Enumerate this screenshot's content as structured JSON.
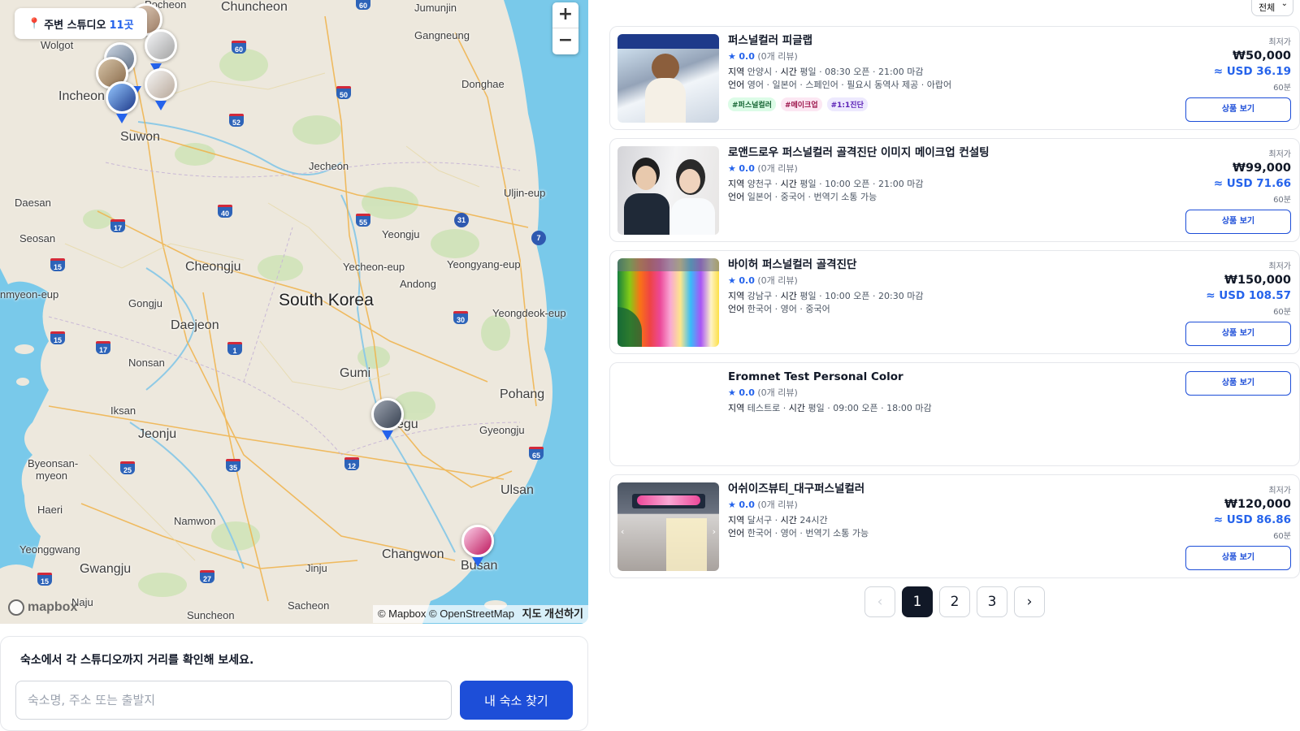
{
  "map": {
    "nearby_prefix": "주변 스튜디오",
    "nearby_count": "11곳",
    "zoom_in": "+",
    "zoom_out": "−",
    "logo_text": "mapbox",
    "attribution": "© Mapbox © OpenStreetMap",
    "improve_map": "지도 개선하기",
    "labels": {
      "pocheon": "Pocheon",
      "chuncheon": "Chuncheon",
      "jumunjin": "Jumunjin",
      "wolgot": "Wolgot",
      "gangneung": "Gangneung",
      "incheon": "Incheon",
      "donghae": "Donghae",
      "suwon": "Suwon",
      "jecheon": "Jecheon",
      "daesan": "Daesan",
      "uljin": "Uljin-eup",
      "seosan": "Seosan",
      "yeongju": "Yeongju",
      "cheongju": "Cheongju",
      "yecheon": "Yecheon-eup",
      "yeongyang": "Yeongyang-eup",
      "andong": "Andong",
      "hongseong": "nmyeon-eup",
      "gongju": "Gongju",
      "south_korea": "South Korea",
      "daejeon": "Daejeon",
      "yeongdeok": "Yeongdeok-eup",
      "nonsan": "Nonsan",
      "gumi": "Gumi",
      "pohang": "Pohang",
      "iksan": "Iksan",
      "daegu": "egu",
      "gyeongju": "Gyeongju",
      "jeonju": "Jeonju",
      "byeongsan": "Byeonsan-",
      "myeon": "myeon",
      "ulsan": "Ulsan",
      "haeri": "Haeri",
      "namwon": "Namwon",
      "yeonggwang": "Yeonggwang",
      "changwon": "Changwon",
      "gwangju": "Gwangju",
      "jinju": "Jinju",
      "busan": "Busan",
      "naju": "Naju",
      "suncheon": "Suncheon",
      "sacheon": "Sacheon"
    },
    "highways": [
      "60",
      "60",
      "50",
      "52",
      "40",
      "55",
      "31",
      "7",
      "17",
      "15",
      "30",
      "15",
      "17",
      "1",
      "65",
      "25",
      "35",
      "12",
      "27",
      "15"
    ]
  },
  "distance": {
    "title": "숙소에서 각 스튜디오까지 거리를 확인해 보세요.",
    "placeholder": "숙소명, 주소 또는 출발지",
    "button": "내 숙소 찾기"
  },
  "sort": {
    "label": "전체"
  },
  "listings": [
    {
      "title": "퍼스널컬러 피글랩",
      "rating": "0.0",
      "reviews": "(0개 리뷰)",
      "region_label": "지역",
      "region": "안양시",
      "hours_label": "시간",
      "hours": "평일 · 08:30 오픈 · 21:00 마감",
      "lang_label": "언어",
      "languages": "영어 · 일본어 · 스페인어 · 필요시 동역사 제공 · 아랍어",
      "tags": [
        "#퍼스널컬러",
        "#메이크업",
        "#1:1진단"
      ],
      "price_label": "최저가",
      "krw": "₩50,000",
      "usd": "≈ USD 36.19",
      "duration": "60분",
      "button": "상품 보기"
    },
    {
      "title": "로앤드로우 퍼스널컬러 골격진단 이미지 메이크업 컨설팅",
      "rating": "0.0",
      "reviews": "(0개 리뷰)",
      "region_label": "지역",
      "region": "양천구",
      "hours_label": "시간",
      "hours": "평일 · 10:00 오픈 · 21:00 마감",
      "lang_label": "언어",
      "languages": "일본어 · 중국어 · 번역기 소통 가능",
      "price_label": "최저가",
      "krw": "₩99,000",
      "usd": "≈ USD 71.66",
      "duration": "60분",
      "button": "상품 보기"
    },
    {
      "title": "바이허 퍼스널컬러 골격진단",
      "rating": "0.0",
      "reviews": "(0개 리뷰)",
      "region_label": "지역",
      "region": "강남구",
      "hours_label": "시간",
      "hours": "평일 · 10:00 오픈 · 20:30 마감",
      "lang_label": "언어",
      "languages": "한국어 · 영어 · 중국어",
      "price_label": "최저가",
      "krw": "₩150,000",
      "usd": "≈ USD 108.57",
      "duration": "60분",
      "button": "상품 보기"
    },
    {
      "title": "Eromnet Test Personal Color",
      "rating": "0.0",
      "reviews": "(0개 리뷰)",
      "region_label": "지역",
      "region": "테스트로",
      "hours_label": "시간",
      "hours": "평일 · 09:00 오픈 · 18:00 마감",
      "button": "상품 보기"
    },
    {
      "title": "어쉬이즈뷰티_대구퍼스널컬러",
      "rating": "0.0",
      "reviews": "(0개 리뷰)",
      "region_label": "지역",
      "region": "달서구",
      "hours_label": "시간",
      "hours": "24시간",
      "lang_label": "언어",
      "languages": "한국어 · 영어 · 번역기 소통 가능",
      "price_label": "최저가",
      "krw": "₩120,000",
      "usd": "≈ USD 86.86",
      "duration": "60분",
      "button": "상품 보기"
    }
  ],
  "pagination": {
    "prev": "‹",
    "pages": [
      "1",
      "2",
      "3"
    ],
    "next": "›",
    "current": "1"
  },
  "colors": {
    "accent": "#2563eb",
    "button": "#1d4ed8",
    "water": "#79c9ea",
    "land": "#ede8dd"
  }
}
